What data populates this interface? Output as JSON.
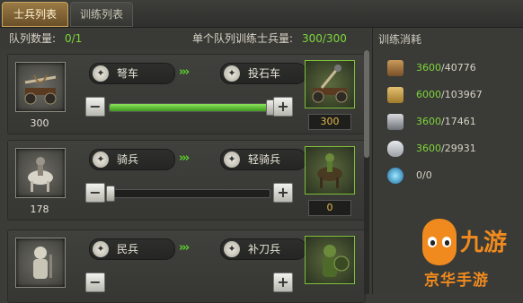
{
  "tabs": [
    {
      "label": "士兵列表",
      "active": true
    },
    {
      "label": "训练列表",
      "active": false
    }
  ],
  "info": {
    "queue_label": "队列数量:",
    "queue_value": "0/1",
    "capacity_label": "单个队列训练士兵量:",
    "capacity_value": "300/300"
  },
  "rows": [
    {
      "from_name": "弩车",
      "to_name": "投石车",
      "count": "300",
      "target_count": "300",
      "slider_fraction": 1.0
    },
    {
      "from_name": "骑兵",
      "to_name": "轻骑兵",
      "count": "178",
      "target_count": "0",
      "slider_fraction": 0.0
    },
    {
      "from_name": "民兵",
      "to_name": "补刀兵",
      "count": "",
      "target_count": "",
      "slider_fraction": 0.0
    }
  ],
  "controls": {
    "minus": "−",
    "plus": "+",
    "arrows": "›››"
  },
  "resources_panel": {
    "title": "训练消耗",
    "items": [
      {
        "icon": "wood-log-icon",
        "have": "3600",
        "total": "/40776"
      },
      {
        "icon": "wheat-icon",
        "have": "6000",
        "total": "/103967"
      },
      {
        "icon": "iron-ingot-icon",
        "have": "3600",
        "total": "/17461"
      },
      {
        "icon": "stone-ore-icon",
        "have": "3600",
        "total": "/29931"
      },
      {
        "icon": "gem-orb-icon",
        "have": "0/0",
        "total": ""
      }
    ]
  },
  "watermark": {
    "logo_text": "九游",
    "sub_text": "京华手游"
  },
  "colors": {
    "accent_green": "#7fd63a",
    "brand_orange": "#f08a1e",
    "gold": "#e3b84a"
  }
}
